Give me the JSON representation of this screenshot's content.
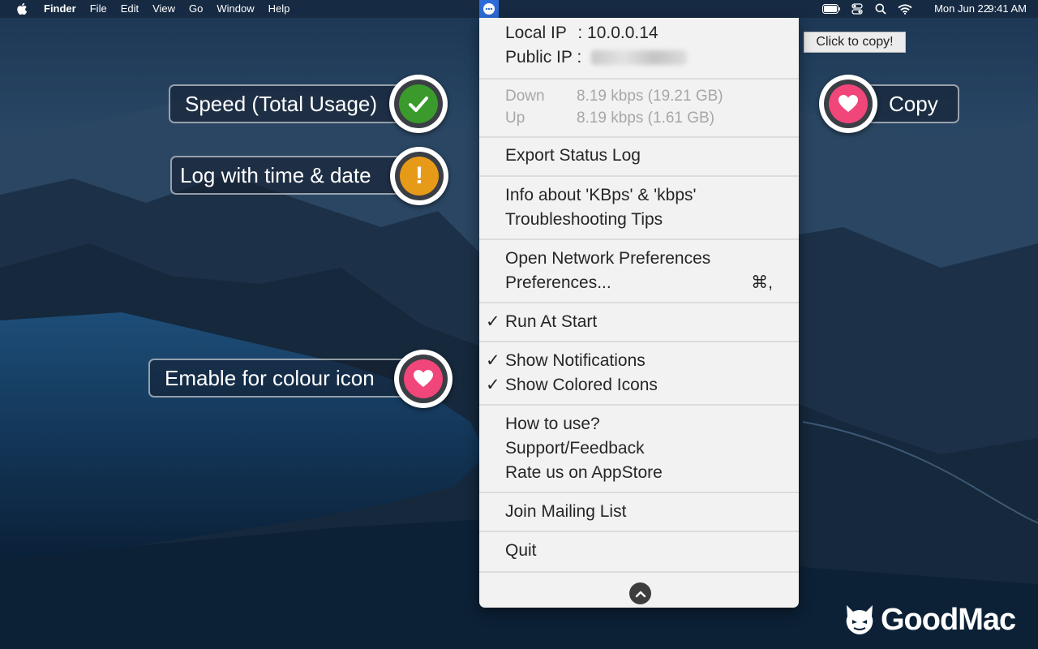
{
  "menubar": {
    "app_name": "Finder",
    "menus": [
      "File",
      "Edit",
      "View",
      "Go",
      "Window",
      "Help"
    ],
    "date": "Mon Jun 22",
    "time": "9:41 AM"
  },
  "callouts": {
    "speed": "Speed (Total Usage)",
    "log": "Log with time & date",
    "colour": "Emable for colour icon",
    "copy": "Copy"
  },
  "tooltip": "Click to copy!",
  "menu": {
    "local_ip_label": "Local IP",
    "local_ip_value": ": 10.0.0.14",
    "public_ip_label": "Public IP :",
    "down_label": "Down",
    "down_value": "8.19 kbps (19.21 GB)",
    "up_label": "Up",
    "up_value": "8.19 kbps (1.61 GB)",
    "export_log": "Export Status Log",
    "info_kbps": "Info about 'KBps' & 'kbps'",
    "troubleshooting": "Troubleshooting Tips",
    "open_network_prefs": "Open Network Preferences",
    "preferences": "Preferences...",
    "preferences_shortcut": "⌘,",
    "run_at_start": "Run At Start",
    "show_notifications": "Show Notifications",
    "show_colored_icons": "Show Colored Icons",
    "how_to_use": "How to use?",
    "support": "Support/Feedback",
    "rate": "Rate us on AppStore",
    "mailing_list": "Join Mailing List",
    "quit": "Quit"
  },
  "logo": "GoodMac",
  "colors": {
    "accent_blue": "#2f6bd8",
    "check_green": "#3a9b2c",
    "warn_orange": "#e79a18",
    "heart_pink": "#f0467a"
  },
  "icons": [
    "apple-icon",
    "tray-app-icon",
    "battery-icon",
    "control-center-icon",
    "search-icon",
    "wifi-icon",
    "checkmark-icon",
    "exclamation-icon",
    "heart-icon",
    "chevron-up-icon"
  ]
}
